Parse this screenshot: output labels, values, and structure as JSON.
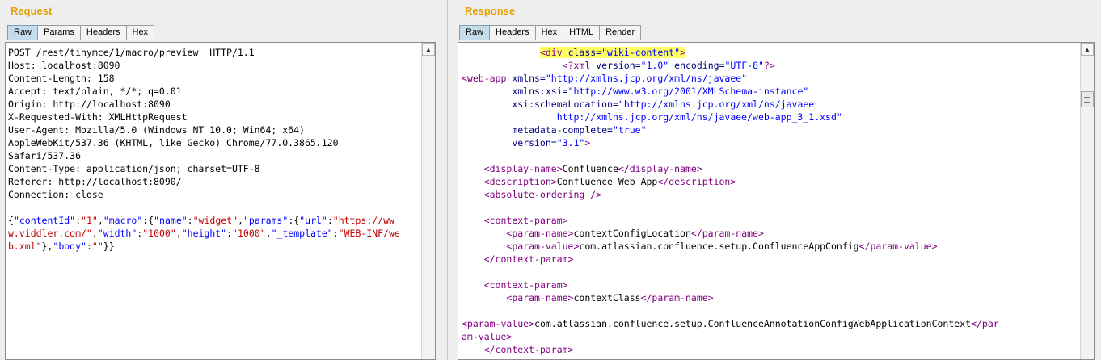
{
  "request": {
    "title": "Request",
    "tabs": [
      "Raw",
      "Params",
      "Headers",
      "Hex"
    ],
    "active_tab": "Raw",
    "headers": [
      "POST /rest/tinymce/1/macro/preview  HTTP/1.1",
      "Host: localhost:8090",
      "Content-Length: 158",
      "Accept: text/plain, */*; q=0.01",
      "Origin: http://localhost:8090",
      "X-Requested-With: XMLHttpRequest",
      "User-Agent: Mozilla/5.0 (Windows NT 10.0; Win64; x64)",
      "AppleWebKit/537.36 (KHTML, like Gecko) Chrome/77.0.3865.120",
      "Safari/537.36",
      "Content-Type: application/json; charset=UTF-8",
      "Referer: http://localhost:8090/",
      "Connection: close"
    ],
    "body": {
      "contentId": "1",
      "macro_name": "widget",
      "url": "https://www.viddler.com/",
      "width": "1000",
      "height": "1000",
      "_template": "WEB-INF/web.xml",
      "body": ""
    }
  },
  "response": {
    "title": "Response",
    "tabs": [
      "Headers",
      "Hex",
      "HTML",
      "Render"
    ],
    "active_tab": "Raw",
    "wiki_div_class": "wiki-content",
    "xml_version": "1.0",
    "xml_encoding": "UTF-8",
    "xmlns": "http://xmlns.jcp.org/xml/ns/javaee",
    "xmlns_xsi": "http://www.w3.org/2001/XMLSchema-instance",
    "schema_location_1": "http://xmlns.jcp.org/xml/ns/javaee",
    "schema_location_2": "http://xmlns.jcp.org/xml/ns/javaee/web-app_3_1.xsd",
    "metadata_complete": "true",
    "version": "3.1",
    "display_name": "Confluence",
    "description": "Confluence Web App",
    "context_params": [
      {
        "name": "contextConfigLocation",
        "value": "com.atlassian.confluence.setup.ConfluenceAppConfig"
      },
      {
        "name": "contextClass",
        "value": "com.atlassian.confluence.setup.ConfluenceAnnotationConfigWebApplicationContext"
      }
    ]
  }
}
